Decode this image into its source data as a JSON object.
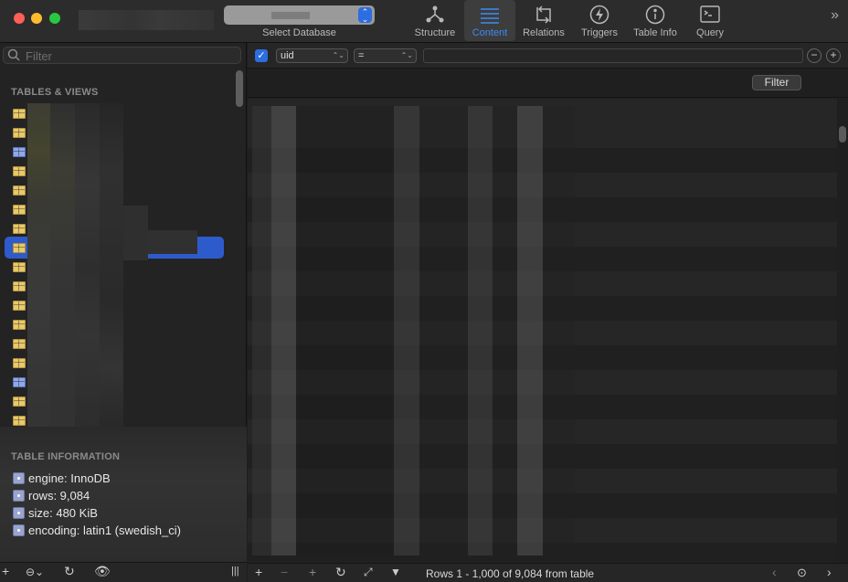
{
  "toolbar": {
    "db_select_label": "Select Database",
    "buttons": [
      {
        "label": "Structure",
        "icon": "structure-icon"
      },
      {
        "label": "Content",
        "icon": "content-icon",
        "active": true
      },
      {
        "label": "Relations",
        "icon": "relations-icon"
      },
      {
        "label": "Triggers",
        "icon": "triggers-icon"
      },
      {
        "label": "Table Info",
        "icon": "info-icon"
      },
      {
        "label": "Query",
        "icon": "terminal-icon"
      }
    ],
    "overflow_icon": "double-chevron-right-icon",
    "accent_color": "#3d8bf5"
  },
  "sidebar": {
    "filter_placeholder": "Filter",
    "tables_title": "TABLES & VIEWS",
    "info_title": "TABLE INFORMATION",
    "info": [
      "engine: InnoDB",
      "rows: 9,084",
      "size: 480 KiB",
      "encoding: latin1 (swedish_ci)"
    ],
    "items": [
      "table",
      "table",
      "view",
      "table",
      "table",
      "table",
      "table",
      "table",
      "table",
      "table",
      "table",
      "table",
      "table",
      "table",
      "view",
      "table",
      "table"
    ],
    "selected_index": 7,
    "selection_color": "#2e5bcc"
  },
  "content": {
    "filter": {
      "enabled": true,
      "field": "uid",
      "operator": "=",
      "value": "",
      "button_label": "Filter"
    },
    "status": "Rows 1 - 1,000 of 9,084 from table"
  }
}
